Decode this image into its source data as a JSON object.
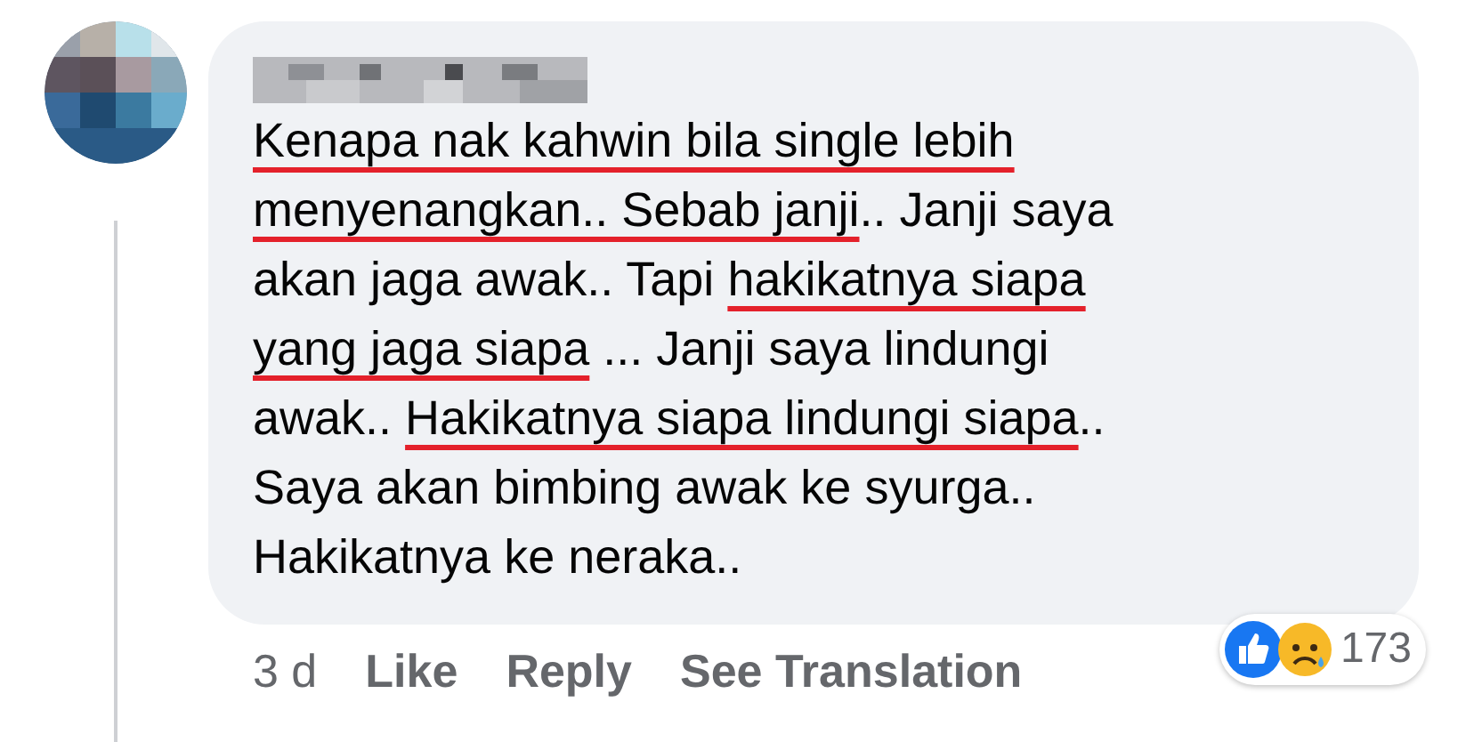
{
  "comment": {
    "lines": [
      [
        {
          "text": "Kenapa nak kahwin bila single lebih",
          "underlined": true
        }
      ],
      [
        {
          "text": "menyenangkan.. Sebab janji",
          "underlined": true
        },
        {
          "text": ".. Janji saya",
          "underlined": false
        }
      ],
      [
        {
          "text": "akan jaga awak.. Tapi ",
          "underlined": false
        },
        {
          "text": "hakikatnya siapa",
          "underlined": true
        }
      ],
      [
        {
          "text": "yang jaga siapa",
          "underlined": true
        },
        {
          "text": " ... Janji saya lindungi",
          "underlined": false
        }
      ],
      [
        {
          "text": "awak.. ",
          "underlined": false
        },
        {
          "text": "Hakikatnya siapa lindungi siapa",
          "underlined": true
        },
        {
          "text": "..",
          "underlined": false
        }
      ],
      [
        {
          "text": "Saya akan bimbing awak ke syurga..",
          "underlined": false
        }
      ],
      [
        {
          "text": "Hakikatnya ke neraka..",
          "underlined": false
        }
      ]
    ],
    "actions": [
      {
        "kind": "time",
        "label": "3 d"
      },
      {
        "kind": "link",
        "label": "Like"
      },
      {
        "kind": "link",
        "label": "Reply"
      },
      {
        "kind": "link",
        "label": "See Translation"
      }
    ],
    "reactions": {
      "count": "173"
    }
  }
}
